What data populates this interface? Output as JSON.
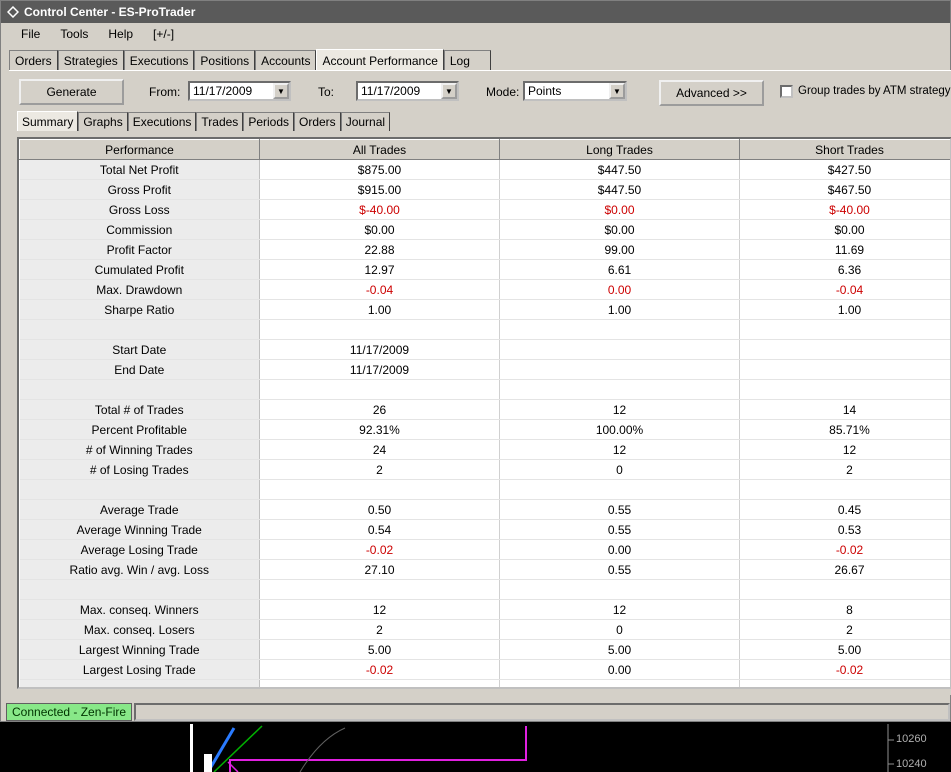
{
  "window": {
    "title": "Control Center - ES-ProTrader"
  },
  "menu": [
    "File",
    "Tools",
    "Help",
    "[+/-]"
  ],
  "main_tabs": [
    {
      "label": "Orders",
      "active": false
    },
    {
      "label": "Strategies",
      "active": false
    },
    {
      "label": "Executions",
      "active": false
    },
    {
      "label": "Positions",
      "active": false
    },
    {
      "label": "Accounts",
      "active": false
    },
    {
      "label": "Account Performance",
      "active": true
    },
    {
      "label": "Log",
      "active": false
    }
  ],
  "toolbar": {
    "generate_label": "Generate",
    "from_label": "From:",
    "from_value": "11/17/2009",
    "to_label": "To:",
    "to_value": "11/17/2009",
    "mode_label": "Mode:",
    "mode_value": "Points",
    "advanced_label": "Advanced >>",
    "group_label": "Group trades by ATM strategy",
    "group_checked": false
  },
  "sub_tabs": [
    {
      "label": "Summary",
      "active": true
    },
    {
      "label": "Graphs",
      "active": false
    },
    {
      "label": "Executions",
      "active": false
    },
    {
      "label": "Trades",
      "active": false
    },
    {
      "label": "Periods",
      "active": false
    },
    {
      "label": "Orders",
      "active": false
    },
    {
      "label": "Journal",
      "active": false
    }
  ],
  "table": {
    "headers": [
      "Performance",
      "All Trades",
      "Long Trades",
      "Short Trades"
    ],
    "rows": [
      {
        "cells": [
          "Total Net Profit",
          "$875.00",
          "$447.50",
          "$427.50"
        ],
        "neg": [
          false,
          false,
          false,
          false
        ]
      },
      {
        "cells": [
          "Gross Profit",
          "$915.00",
          "$447.50",
          "$467.50"
        ],
        "neg": [
          false,
          false,
          false,
          false
        ]
      },
      {
        "cells": [
          "Gross Loss",
          "$-40.00",
          "$0.00",
          "$-40.00"
        ],
        "neg": [
          false,
          true,
          true,
          true
        ]
      },
      {
        "cells": [
          "Commission",
          "$0.00",
          "$0.00",
          "$0.00"
        ],
        "neg": [
          false,
          false,
          false,
          false
        ]
      },
      {
        "cells": [
          "Profit Factor",
          "22.88",
          "99.00",
          "11.69"
        ],
        "neg": [
          false,
          false,
          false,
          false
        ]
      },
      {
        "cells": [
          "Cumulated Profit",
          "12.97",
          "6.61",
          "6.36"
        ],
        "neg": [
          false,
          false,
          false,
          false
        ]
      },
      {
        "cells": [
          "Max. Drawdown",
          "-0.04",
          "0.00",
          "-0.04"
        ],
        "neg": [
          false,
          true,
          true,
          true
        ]
      },
      {
        "cells": [
          "Sharpe Ratio",
          "1.00",
          "1.00",
          "1.00"
        ],
        "neg": [
          false,
          false,
          false,
          false
        ]
      },
      {
        "cells": [
          "",
          "",
          "",
          ""
        ],
        "neg": [
          false,
          false,
          false,
          false
        ]
      },
      {
        "cells": [
          "Start Date",
          "11/17/2009",
          "",
          ""
        ],
        "neg": [
          false,
          false,
          false,
          false
        ]
      },
      {
        "cells": [
          "End Date",
          "11/17/2009",
          "",
          ""
        ],
        "neg": [
          false,
          false,
          false,
          false
        ]
      },
      {
        "cells": [
          "",
          "",
          "",
          ""
        ],
        "neg": [
          false,
          false,
          false,
          false
        ]
      },
      {
        "cells": [
          "Total # of Trades",
          "26",
          "12",
          "14"
        ],
        "neg": [
          false,
          false,
          false,
          false
        ]
      },
      {
        "cells": [
          "Percent Profitable",
          "92.31%",
          "100.00%",
          "85.71%"
        ],
        "neg": [
          false,
          false,
          false,
          false
        ]
      },
      {
        "cells": [
          "# of Winning Trades",
          "24",
          "12",
          "12"
        ],
        "neg": [
          false,
          false,
          false,
          false
        ]
      },
      {
        "cells": [
          "# of Losing Trades",
          "2",
          "0",
          "2"
        ],
        "neg": [
          false,
          false,
          false,
          false
        ]
      },
      {
        "cells": [
          "",
          "",
          "",
          ""
        ],
        "neg": [
          false,
          false,
          false,
          false
        ]
      },
      {
        "cells": [
          "Average Trade",
          "0.50",
          "0.55",
          "0.45"
        ],
        "neg": [
          false,
          false,
          false,
          false
        ]
      },
      {
        "cells": [
          "Average Winning Trade",
          "0.54",
          "0.55",
          "0.53"
        ],
        "neg": [
          false,
          false,
          false,
          false
        ]
      },
      {
        "cells": [
          "Average Losing Trade",
          "-0.02",
          "0.00",
          "-0.02"
        ],
        "neg": [
          false,
          true,
          false,
          true
        ]
      },
      {
        "cells": [
          "Ratio avg. Win / avg. Loss",
          "27.10",
          "0.55",
          "26.67"
        ],
        "neg": [
          false,
          false,
          false,
          false
        ]
      },
      {
        "cells": [
          "",
          "",
          "",
          ""
        ],
        "neg": [
          false,
          false,
          false,
          false
        ]
      },
      {
        "cells": [
          "Max. conseq. Winners",
          "12",
          "12",
          "8"
        ],
        "neg": [
          false,
          false,
          false,
          false
        ]
      },
      {
        "cells": [
          "Max. conseq. Losers",
          "2",
          "0",
          "2"
        ],
        "neg": [
          false,
          false,
          false,
          false
        ]
      },
      {
        "cells": [
          "Largest Winning Trade",
          "5.00",
          "5.00",
          "5.00"
        ],
        "neg": [
          false,
          false,
          false,
          false
        ]
      },
      {
        "cells": [
          "Largest Losing Trade",
          "-0.02",
          "0.00",
          "-0.02"
        ],
        "neg": [
          false,
          true,
          false,
          true
        ]
      },
      {
        "cells": [
          "",
          "",
          "",
          ""
        ],
        "neg": [
          false,
          false,
          false,
          false
        ]
      }
    ]
  },
  "status": {
    "connection": "Connected - Zen-Fire"
  },
  "background_chart": {
    "price_labels": [
      "10260",
      "10240"
    ]
  },
  "colors": {
    "negative": "#cc0000",
    "status_ok": "#88e888",
    "title_bar": "#5a5a5a"
  }
}
